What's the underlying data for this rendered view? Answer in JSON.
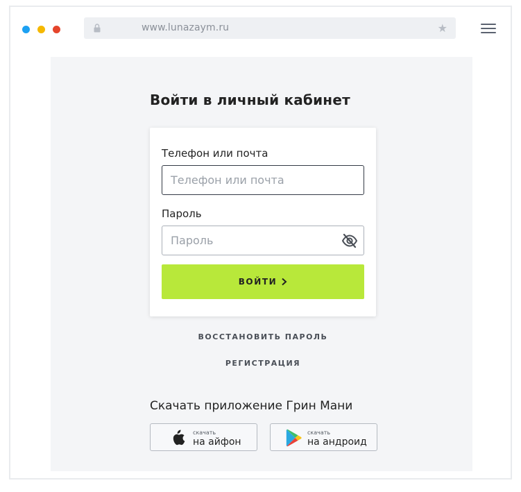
{
  "browser": {
    "url": "www.lunazaym.ru",
    "traffic_colors": [
      "#1da1f2",
      "#f5b800",
      "#e5452b"
    ]
  },
  "login": {
    "title": "Войти в личный кабинет",
    "phone_label": "Телефон или почта",
    "phone_placeholder": "Телефон или почта",
    "password_label": "Пароль",
    "password_placeholder": "Пароль",
    "submit_label": "ВОЙТИ"
  },
  "links": {
    "recover": "ВОССТАНОВИТЬ ПАРОЛЬ",
    "register": "РЕГИСТРАЦИЯ"
  },
  "app": {
    "title": "Скачать приложение Грин Мани",
    "ios_small": "скачать",
    "ios_big": "на айфон",
    "android_small": "скачать",
    "android_big": "на андроид"
  },
  "colors": {
    "accent": "#b8e83a",
    "page_bg": "#f4f5f7"
  },
  "icons": [
    "lock-icon",
    "star-icon",
    "hamburger-menu-icon",
    "eye-slash-icon",
    "chevron-right-icon",
    "apple-icon",
    "google-play-icon"
  ]
}
